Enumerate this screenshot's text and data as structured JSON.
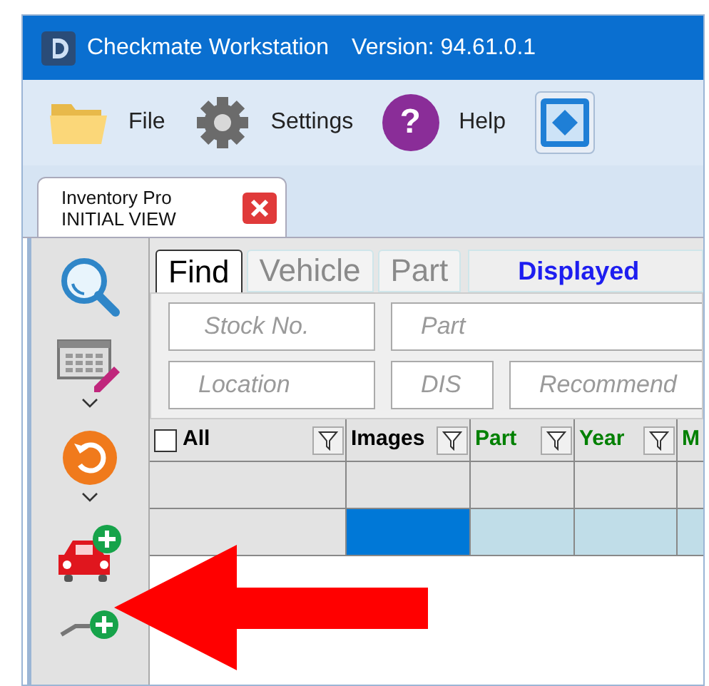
{
  "window": {
    "title": "Checkmate Workstation",
    "version": "Version: 94.61.0.1"
  },
  "toolbar": [
    {
      "kind": "menu",
      "label": "File"
    },
    {
      "kind": "menu",
      "label": "Settings"
    },
    {
      "kind": "menu",
      "label": "Help",
      "glyph": "?"
    },
    {
      "kind": "icon"
    }
  ],
  "doc_tab": {
    "line1": "Inventory Pro",
    "line2": "INITIAL VIEW"
  },
  "sidebar": [
    {
      "has_menu": false
    },
    {
      "has_menu": true
    },
    {
      "has_menu": true
    },
    {
      "has_menu": false
    },
    {
      "has_menu": false
    }
  ],
  "tabs": [
    {
      "label": "Find",
      "selected": true
    },
    {
      "label": "Vehicle",
      "selected": false
    },
    {
      "label": "Part",
      "selected": false
    }
  ],
  "status_label": "Displayed",
  "fields_row1": [
    {
      "placeholder": "Stock No."
    },
    {
      "placeholder": "Part"
    }
  ],
  "fields_row2": [
    {
      "placeholder": "Location"
    },
    {
      "placeholder": "DIS"
    },
    {
      "placeholder": "Recommend"
    }
  ],
  "table": {
    "columns": [
      {
        "label": "All",
        "kind": "checkbox",
        "checked": false,
        "color": "#000000"
      },
      {
        "label": "Images",
        "kind": "text",
        "color": "#000000"
      },
      {
        "label": "Part",
        "kind": "text",
        "color": "#008000"
      },
      {
        "label": "Year",
        "kind": "text",
        "color": "#008000"
      },
      {
        "label": "M",
        "kind": "text",
        "color": "#008000"
      }
    ],
    "rows": [
      {
        "selected": false,
        "focused": [
          false,
          false,
          false,
          false,
          false
        ]
      },
      {
        "selected": true,
        "focused": [
          false,
          true,
          false,
          false,
          false
        ]
      }
    ]
  }
}
